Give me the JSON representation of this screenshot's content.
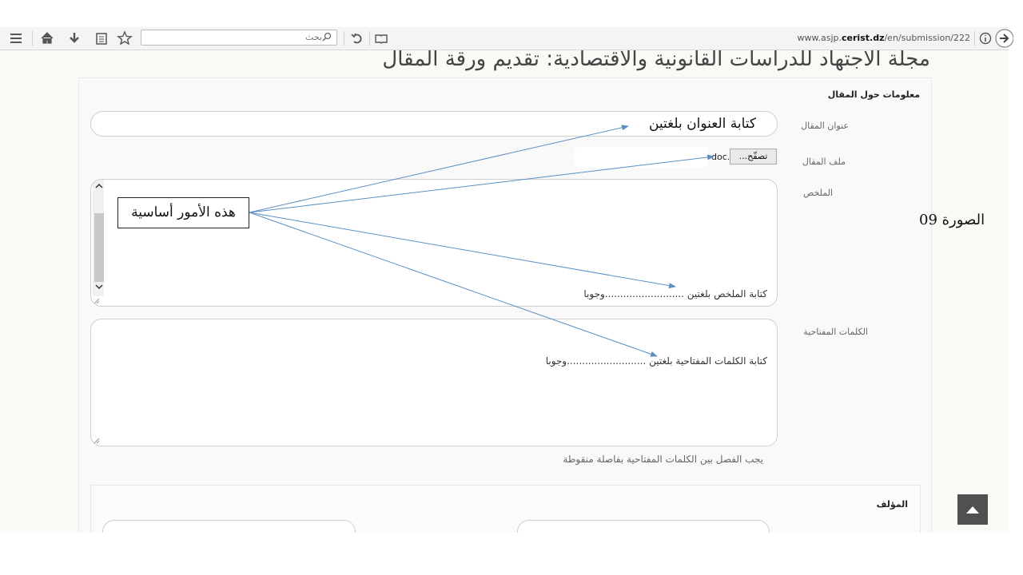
{
  "browser": {
    "search_placeholder": "بحث",
    "url_prefix": "www.asjp.",
    "url_domain": "cerist.dz",
    "url_path": "/en/submission/222"
  },
  "page": {
    "title": "مجلة الاجتهاد للدراسات القانونية والاقتصادية: تقديم ورقة المقال"
  },
  "article_info": {
    "section_title": "معلومات حول المقال",
    "title_label": "عنوان المقال",
    "title_value": "كتابة العنوان بلغتين",
    "file_label": "ملف المقال",
    "browse_label": "تصفّح...",
    "file_name": "doc.",
    "abstract_label": "الملخص",
    "abstract_value": "كتابة الملخص بلغتين ..........................وجوبا",
    "keywords_label": "الكلمات المفتاحية",
    "keywords_value": "كتابة الكلمات المفتاحية بلغتين ..........................وجوبا",
    "keywords_help": "يجب الفصل بين الكلمات المفتاحية بفاصلة منقوطة"
  },
  "author": {
    "section_title": "المؤلف"
  },
  "annotation": {
    "callout_text": "هذه الأمور أساسية",
    "figure_label": "الصورة 09"
  },
  "colors": {
    "arrow": "#5b8fc2",
    "scroll_top_bg": "#505050"
  }
}
